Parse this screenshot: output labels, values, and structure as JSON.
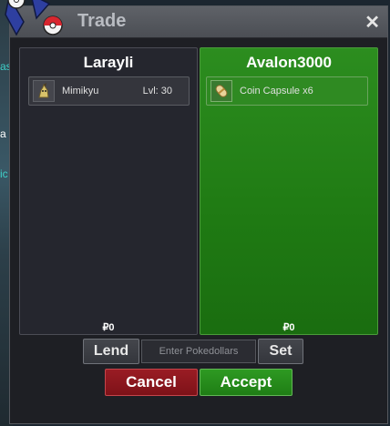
{
  "window": {
    "title": "Trade",
    "close_symbol": "✕",
    "logo_icon": "pokeball-logo-icon"
  },
  "background": {
    "fragment_1": "as",
    "fragment_2": "a",
    "fragment_3": "ic"
  },
  "left_panel": {
    "player_name": "Larayli",
    "money": "₽0",
    "items": [
      {
        "icon": "mimikyu-sprite-icon",
        "name": "Mimikyu",
        "level": "Lvl: 30"
      }
    ]
  },
  "right_panel": {
    "player_name": "Avalon3000",
    "money": "₽0",
    "items": [
      {
        "icon": "coin-capsule-icon",
        "name": "Coin Capsule  x6"
      }
    ]
  },
  "controls": {
    "lend_label": "Lend",
    "money_placeholder": "Enter Pokedollars",
    "set_label": "Set",
    "cancel_label": "Cancel",
    "accept_label": "Accept"
  },
  "colors": {
    "accept_green": "#1f7e15",
    "cancel_red": "#7d1218",
    "panel_dark": "#25262e"
  }
}
